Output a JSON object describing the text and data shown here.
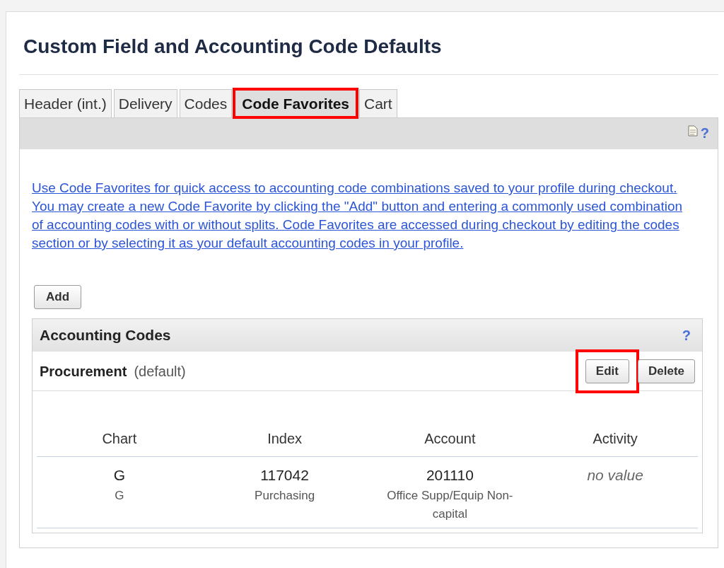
{
  "page_title": "Custom Field and Accounting Code Defaults",
  "tabs": [
    {
      "label": "Header (int.)",
      "selected": false,
      "highlighted": false
    },
    {
      "label": "Delivery",
      "selected": false,
      "highlighted": false
    },
    {
      "label": "Codes",
      "selected": false,
      "highlighted": false
    },
    {
      "label": "Code Favorites",
      "selected": true,
      "highlighted": true
    },
    {
      "label": "Cart",
      "selected": false,
      "highlighted": false
    }
  ],
  "toolbar": {
    "help": "?"
  },
  "intro_link": "Use Code Favorites for quick access to accounting code combinations saved to your profile during checkout. You may create a new Code Favorite by clicking the \"Add\" button and entering a commonly used combination of accounting codes with or without splits. Code Favorites are accessed during checkout by editing the codes section or by selecting it as your default accounting codes in your profile.",
  "add_button": "Add",
  "panel": {
    "title": "Accounting Codes",
    "help": "?",
    "favorite": {
      "name": "Procurement",
      "note": "(default)"
    },
    "buttons": [
      {
        "label": "Edit",
        "highlighted": true
      },
      {
        "label": "Delete",
        "highlighted": false
      }
    ],
    "table": {
      "columns": [
        "Chart",
        "Index",
        "Account",
        "Activity"
      ],
      "rows": [
        {
          "cells": [
            {
              "value": "G",
              "detail": "G",
              "empty": false
            },
            {
              "value": "117042",
              "detail": "Purchasing",
              "empty": false
            },
            {
              "value": "201110",
              "detail": "Office Supp/Equip Non-capital",
              "empty": false
            },
            {
              "value": "no value",
              "empty": true
            }
          ]
        }
      ]
    }
  }
}
